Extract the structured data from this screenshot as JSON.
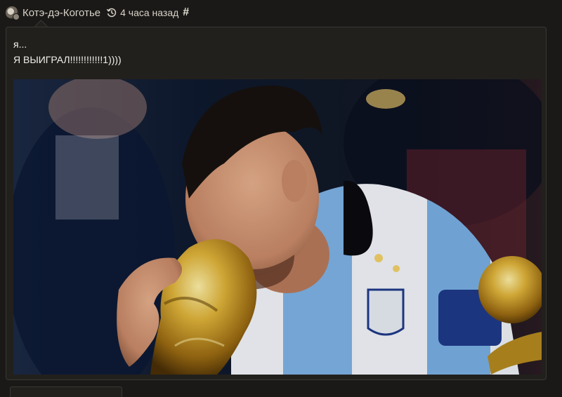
{
  "post": {
    "author": "Котэ-дэ-Коготье",
    "time": "4 часа назад",
    "permalink": "#",
    "lines": [
      "я...",
      "Я ВЫИГРАЛ!!!!!!!!!!!!1))))"
    ]
  },
  "icons": {
    "avatar": "avatar-icon",
    "history": "history-icon"
  },
  "colors": {
    "page_bg": "#1a1917",
    "card_bg": "#22201d",
    "card_border": "#3a3733",
    "text": "#e9e6de"
  }
}
